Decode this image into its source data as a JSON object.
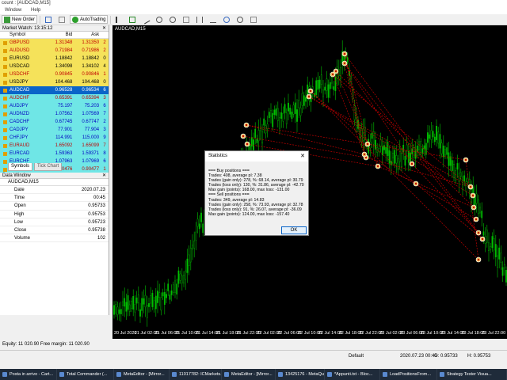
{
  "window_title": "count : [AUDCAD,M15]",
  "menu": [
    "Window",
    "Help"
  ],
  "toolbar": {
    "new_order": "New Order",
    "auto_trading": "AutoTrading"
  },
  "market_watch": {
    "title": "Market Watch: 13:15:12",
    "columns": [
      "Symbol",
      "Bid",
      "Ask",
      ""
    ],
    "rows": [
      {
        "symbol": "GBPUSD",
        "bid": "1.31348",
        "ask": "1.31350",
        "n": "2",
        "bg": "#f5e25a",
        "fg": "#c00000"
      },
      {
        "symbol": "AUDUSD",
        "bid": "0.71984",
        "ask": "0.71986",
        "n": "2",
        "bg": "#f5e25a",
        "fg": "#c00000"
      },
      {
        "symbol": "EURUSD",
        "bid": "1.18842",
        "ask": "1.18842",
        "n": "0",
        "bg": "#f5e25a",
        "fg": "#000000"
      },
      {
        "symbol": "USDCAD",
        "bid": "1.34098",
        "ask": "1.34102",
        "n": "4",
        "bg": "#f5e25a",
        "fg": "#000000"
      },
      {
        "symbol": "USDCHF",
        "bid": "0.90845",
        "ask": "0.90846",
        "n": "1",
        "bg": "#f5e25a",
        "fg": "#c00000"
      },
      {
        "symbol": "USDJPY",
        "bid": "104.468",
        "ask": "104.468",
        "n": "0",
        "bg": "#f5e25a",
        "fg": "#000000"
      },
      {
        "symbol": "AUDCAD",
        "bid": "0.96528",
        "ask": "0.96534",
        "n": "6",
        "bg": "#0a64c8",
        "fg": "#ffffff"
      },
      {
        "symbol": "AUDCHF",
        "bid": "0.65391",
        "ask": "0.65394",
        "n": "3",
        "bg": "#6fe6e6",
        "fg": "#c00000"
      },
      {
        "symbol": "AUDJPY",
        "bid": "75.197",
        "ask": "75.203",
        "n": "6",
        "bg": "#6fe6e6",
        "fg": "#0000c0"
      },
      {
        "symbol": "AUDNZD",
        "bid": "1.07562",
        "ask": "1.07569",
        "n": "7",
        "bg": "#6fe6e6",
        "fg": "#0000c0"
      },
      {
        "symbol": "CADCHF",
        "bid": "0.67745",
        "ask": "0.67747",
        "n": "2",
        "bg": "#6fe6e6",
        "fg": "#0000c0"
      },
      {
        "symbol": "CADJPY",
        "bid": "77.901",
        "ask": "77.904",
        "n": "3",
        "bg": "#6fe6e6",
        "fg": "#0000c0"
      },
      {
        "symbol": "CHFJPY",
        "bid": "114.991",
        "ask": "115.000",
        "n": "9",
        "bg": "#6fe6e6",
        "fg": "#0000c0"
      },
      {
        "symbol": "EURAUD",
        "bid": "1.65092",
        "ask": "1.65099",
        "n": "7",
        "bg": "#6fe6e6",
        "fg": "#c00000"
      },
      {
        "symbol": "EURCAD",
        "bid": "1.59363",
        "ask": "1.59371",
        "n": "8",
        "bg": "#6fe6e6",
        "fg": "#0000c0"
      },
      {
        "symbol": "EURCHF",
        "bid": "1.07963",
        "ask": "1.07969",
        "n": "6",
        "bg": "#6fe6e6",
        "fg": "#0000c0"
      },
      {
        "symbol": "EURGBP",
        "bid": "0.90476",
        "ask": "0.90477",
        "n": "1",
        "bg": "#6fe6e6",
        "fg": "#c00000"
      },
      {
        "symbol": "EURJPY",
        "bid": "124.150",
        "ask": "124.152",
        "n": "2",
        "bg": "#6fe6e6",
        "fg": "#0000c0"
      }
    ],
    "tabs": [
      "Symbols",
      "Tick Chart"
    ]
  },
  "data_window": {
    "title": "Data Window",
    "symbol": "AUDCAD,M15",
    "rows": [
      {
        "k": "Date",
        "v": "2020.07.23"
      },
      {
        "k": "Time",
        "v": "00:45"
      },
      {
        "k": "Open",
        "v": "0.95733"
      },
      {
        "k": "High",
        "v": "0.95753"
      },
      {
        "k": "Low",
        "v": "0.95723"
      },
      {
        "k": "Close",
        "v": "0.95738"
      },
      {
        "k": "Volume",
        "v": "102"
      }
    ]
  },
  "chart": {
    "title": "AUDCAD,M15",
    "bg": "#000000",
    "candle_color": "#00c000",
    "trade_line_color": "#c00000",
    "x_labels": [
      "20 Jul 2020",
      "21 Jul 02:00",
      "21 Jul 06:00",
      "21 Jul 10:00",
      "21 Jul 14:00",
      "21 Jul 18:00",
      "21 Jul 22:00",
      "22 Jul 02:00",
      "22 Jul 06:00",
      "22 Jul 10:00",
      "22 Jul 14:00",
      "22 Jul 18:00",
      "22 Jul 22:00",
      "23 Jul 02:00",
      "23 Jul 06:00",
      "23 Jul 10:00",
      "23 Jul 14:00",
      "23 Jul 18:00",
      "23 Jul 22:00"
    ]
  },
  "dialog": {
    "title": "Statistics",
    "close": "✕",
    "lines": [
      "=== Buy positions ===",
      "Trades: 408, average pl: 7.38",
      "Trades (gain only): 278, %: 68.14, average pl: 30.79",
      "Trades (loss only): 130, %: 31.86, average pl: -42.70",
      "Max gain (points): 168.00, max loss: -131.00",
      "=== Sell positions ===",
      "Trades: 349, average pl: 14.83",
      "Trades (gain only): 258, %: 73.93, average pl: 32.78",
      "Trades (loss only): 91, %: 26.07, average pl: -36.09",
      "Max gain (points): 124.00, max loss: -157.40"
    ],
    "ok": "OK"
  },
  "status": {
    "left": "Equity: 11 020.90    Free margin: 11 020.90",
    "profile": "Default",
    "datetime": "2020.07.23 00:45",
    "open": "O: 0.95733",
    "high": "H: 0.95753"
  },
  "taskbar": [
    "Posta in arrivo - Cart...",
    "Total Commander (...",
    "MetaEditor - [Mirror...",
    "11017782: ICMarkets...",
    "MetaEditor - [Mirror...",
    "13425176 - MetaQu...",
    "*Appunti.txt - Bloc...",
    "LoadPositionsFrom...",
    "Strategy Tester Visua..."
  ]
}
